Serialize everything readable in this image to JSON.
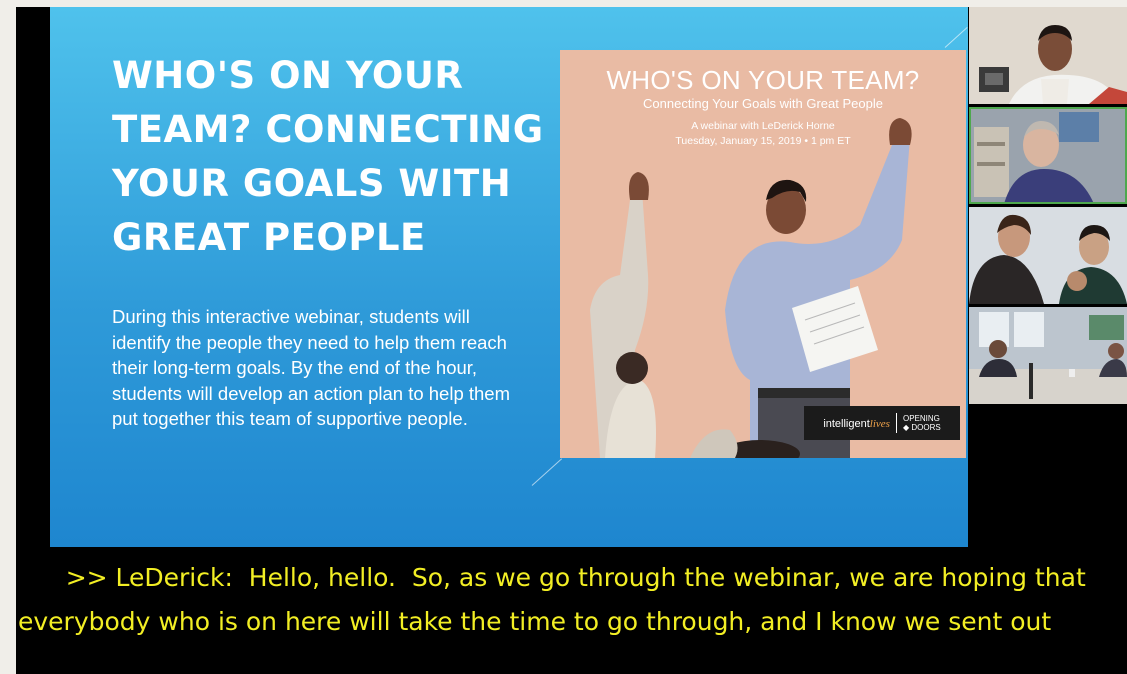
{
  "slide": {
    "title": "WHO'S ON YOUR TEAM? CONNECTING YOUR GOALS WITH GREAT PEOPLE",
    "body": "During this interactive webinar, students will identify the people they need to help them reach their long-term goals. By the end of the hour, students will develop an action plan to help them put together this team of supportive people.",
    "poster": {
      "title": "WHO'S ON YOUR TEAM?",
      "subtitle": "Connecting Your Goals with Great People",
      "line1": "A webinar with LeDerick Horne",
      "line2": "Tuesday, January 15, 2019 • 1 pm ET",
      "logo_left": "intelligent",
      "logo_left_accent": "lives",
      "logo_right": "OPENING\n◆ DOORS"
    }
  },
  "participants": [
    {
      "role": "presenter"
    },
    {
      "role": "participant"
    },
    {
      "role": "participant"
    },
    {
      "role": "participant"
    }
  ],
  "caption": {
    "text": "      >> LeDerick:  Hello, hello.  So, as we go through the webinar, we are hoping that everybody who is on here will take the time to go through, and I know we sent out"
  },
  "colors": {
    "caption_text": "#f2ee24",
    "slide_bg": "#2f9bd9",
    "poster_bg": "#e9bba4",
    "active_speaker_border": "#4ea84e"
  }
}
